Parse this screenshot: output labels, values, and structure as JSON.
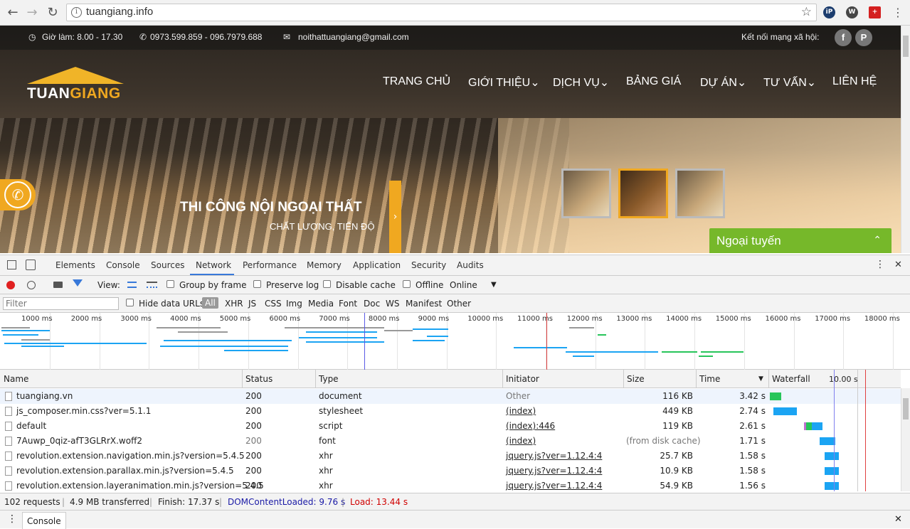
{
  "browser": {
    "url": "tuangiang.info",
    "back_glyph": "←",
    "forward_glyph": "→",
    "reload_glyph": "↻",
    "info_glyph": "i",
    "star_glyph": "☆",
    "extensions": [
      "iP",
      "W",
      "+"
    ]
  },
  "site": {
    "topbar": {
      "hours": "Giờ làm: 8.00 - 17.30",
      "phones": "0973.599.859 - 096.7979.688",
      "email": "noithattuangiang@gmail.com",
      "social_label": "Kết nối mạng xã hội:",
      "facebook_glyph": "f",
      "pinterest_glyph": "P",
      "clock_glyph": "◷",
      "phone_glyph": "✆",
      "mail_glyph": "✉"
    },
    "logo": {
      "part1": "TUAN",
      "part2": "GIANG"
    },
    "nav": [
      "TRANG CHỦ",
      "GIỚI THIỆU⌄",
      "DỊCH VỤ⌄",
      "BẢNG GIÁ",
      "DỰ ÁN⌄",
      "TƯ VẤN⌄",
      "LIÊN HỆ"
    ],
    "slide": {
      "title": "THI CÔNG NỘI NGOẠI THẤT",
      "subtitle": "CHẤT LƯỢNG, TIẾN ĐỘ",
      "arrow": "›"
    },
    "phone_button_glyph": "✆",
    "chat": {
      "label": "Ngoại tuyến",
      "toggle": "⌃"
    }
  },
  "devtools": {
    "tabs": [
      "Elements",
      "Console",
      "Sources",
      "Network",
      "Performance",
      "Memory",
      "Application",
      "Security",
      "Audits"
    ],
    "active_tab": "Network",
    "toolbar": {
      "view_label": "View:",
      "group_by_frame": "Group by frame",
      "preserve_log": "Preserve log",
      "disable_cache": "Disable cache",
      "offline": "Offline",
      "throttle": "Online",
      "throttle_arrow": "▼"
    },
    "filterbar": {
      "filter_placeholder": "Filter",
      "hide_data_urls": "Hide data URLs",
      "types": [
        "All",
        "XHR",
        "JS",
        "CSS",
        "Img",
        "Media",
        "Font",
        "Doc",
        "WS",
        "Manifest",
        "Other"
      ]
    },
    "overview_ticks": [
      "1000 ms",
      "2000 ms",
      "3000 ms",
      "4000 ms",
      "5000 ms",
      "6000 ms",
      "7000 ms",
      "8000 ms",
      "9000 ms",
      "10000 ms",
      "11000 ms",
      "12000 ms",
      "13000 ms",
      "14000 ms",
      "15000 ms",
      "16000 ms",
      "17000 ms",
      "18000 ms"
    ],
    "columns": {
      "name": "Name",
      "status": "Status",
      "type": "Type",
      "initiator": "Initiator",
      "size": "Size",
      "time": "Time",
      "waterfall": "Waterfall",
      "waterfall_scale": "10.00 s",
      "sort_glyph": "▼"
    },
    "rows": [
      {
        "name": "tuangiang.vn",
        "status": "200",
        "type": "document",
        "initiator": "Other",
        "size": "116 KB",
        "time": "3.42 s"
      },
      {
        "name": "js_composer.min.css?ver=5.1.1",
        "status": "200",
        "type": "stylesheet",
        "initiator": "(index)",
        "size": "449 KB",
        "time": "2.74 s"
      },
      {
        "name": "default",
        "status": "200",
        "type": "script",
        "initiator": "(index):446",
        "size": "119 KB",
        "time": "2.61 s"
      },
      {
        "name": "7Auwp_0qiz-afT3GLRrX.woff2",
        "status": "200",
        "type": "font",
        "initiator": "(index)",
        "size": "(from disk cache)",
        "time": "1.71 s"
      },
      {
        "name": "revolution.extension.navigation.min.js?version=5.4.5",
        "status": "200",
        "type": "xhr",
        "initiator": "jquery.js?ver=1.12.4:4",
        "size": "25.7 KB",
        "time": "1.58 s"
      },
      {
        "name": "revolution.extension.parallax.min.js?version=5.4.5",
        "status": "200",
        "type": "xhr",
        "initiator": "jquery.js?ver=1.12.4:4",
        "size": "10.9 KB",
        "time": "1.58 s"
      },
      {
        "name": "revolution.extension.layeranimation.min.js?version=5.4.5",
        "status": "200",
        "type": "xhr",
        "initiator": "jquery.js?ver=1.12.4:4",
        "size": "54.9 KB",
        "time": "1.56 s"
      }
    ],
    "summary": {
      "requests": "102 requests",
      "transferred": "4.9 MB transferred",
      "finish": "Finish: 17.37 s",
      "dom_loaded": "DOMContentLoaded: 9.76 s",
      "load": "Load: 13.44 s"
    },
    "drawer_tab": "Console",
    "close_glyph": "✕",
    "menu_glyph": "⋮"
  },
  "colors": {
    "accent": "#f0a820",
    "chat_green": "#76b82a",
    "dom_blue": "#1a1aa6",
    "load_red": "#d00000",
    "devtools_blue": "#3879d9"
  }
}
